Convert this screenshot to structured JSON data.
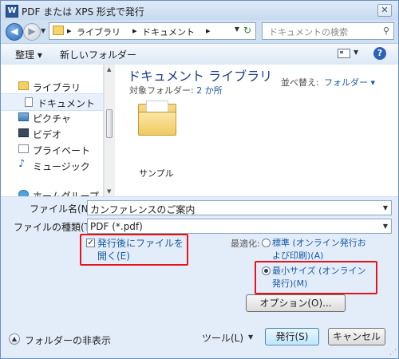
{
  "window": {
    "title": "PDF または XPS 形式で発行",
    "app_icon": "W",
    "close_label": "✕"
  },
  "nav": {
    "path": [
      "ライブラリ",
      "ドキュメント"
    ],
    "separator": "▸",
    "search_placeholder": "ドキュメントの検索"
  },
  "toolbar": {
    "organize": "整理 ▾",
    "new_folder": "新しいフォルダー"
  },
  "sidebar": {
    "items": [
      {
        "label": "ライブラリ",
        "icon": "library-icon",
        "selected": false
      },
      {
        "label": "ドキュメント",
        "icon": "document-icon",
        "selected": true
      },
      {
        "label": "ピクチャ",
        "icon": "picture-icon",
        "selected": false
      },
      {
        "label": "ビデオ",
        "icon": "video-icon",
        "selected": false
      },
      {
        "label": "プライベート",
        "icon": "private-icon",
        "selected": false
      },
      {
        "label": "ミュージック",
        "icon": "music-icon",
        "selected": false
      },
      {
        "label": "ホームグループ",
        "icon": "homegroup-icon",
        "selected": false
      }
    ]
  },
  "content": {
    "library_title": "ドキュメント ライブラリ",
    "target_label": "対象フォルダー:",
    "target_count": "2 か所",
    "sort_label": "並べ替え:",
    "sort_value": "フォルダー ▾",
    "items": [
      {
        "name": "サンプル",
        "icon": "folder-icon"
      }
    ]
  },
  "form": {
    "filename_label": "ファイル名(N):",
    "filename_value": "カンファレンスのご案内",
    "filetype_label": "ファイルの種類(T):",
    "filetype_value": "PDF (*.pdf)",
    "open_after_label": "発行後にファイルを開く(E)",
    "open_after_checked": true,
    "optimize_label": "最適化:",
    "opt_standard_label": "標準 (オンライン発行および印刷)(A)",
    "opt_min_label": "最小サイズ (オンライン発行)(M)",
    "selected_option": "minimum"
  },
  "buttons": {
    "options": "オプション(O)...",
    "tools": "ツール(L)",
    "publish": "発行(S)",
    "cancel": "キャンセル"
  },
  "footer": {
    "hide_folders": "フォルダーの非表示"
  },
  "colors": {
    "highlight_box": "#e8141b",
    "link": "#1a5aa5"
  }
}
